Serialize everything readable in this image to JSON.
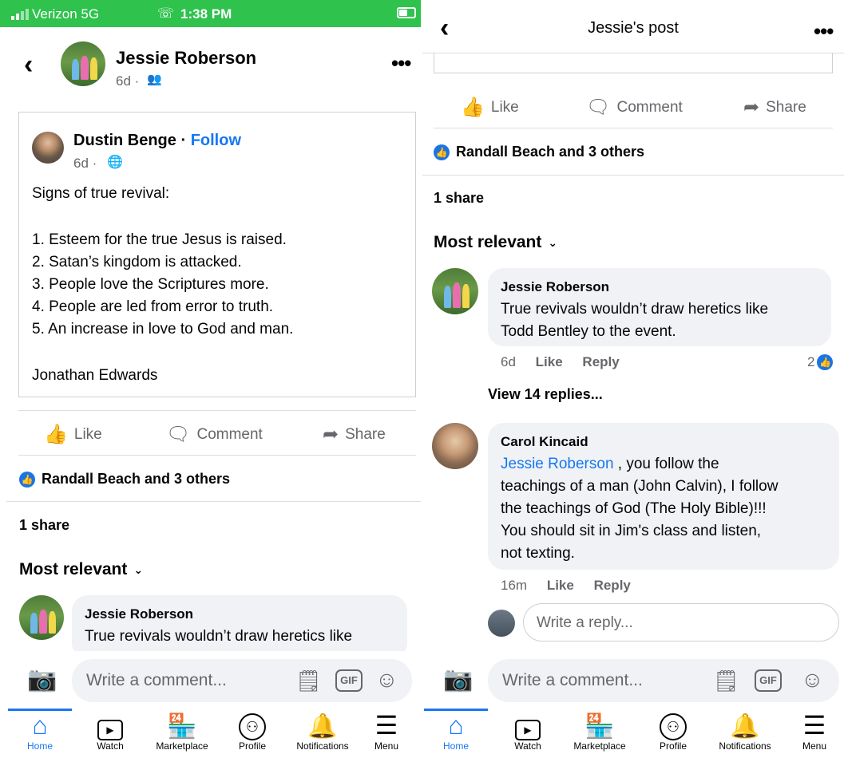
{
  "status_bar": {
    "carrier": "Verizon  5G",
    "time": "1:38 PM"
  },
  "left": {
    "header": {
      "name": "Jessie Roberson",
      "time": "6d ·"
    },
    "shared_post": {
      "author": "Dustin Benge",
      "separator": " · ",
      "follow": "Follow",
      "time": "6d ·",
      "lines": [
        "Signs of true revival:",
        "",
        "1. Esteem for the true Jesus is raised.",
        "2. Satan’s kingdom is attacked.",
        "3. People love the Scriptures more.",
        "4. People are led from error to truth.",
        "5. An increase in love to God and man.",
        "",
        "Jonathan Edwards"
      ]
    },
    "actions": {
      "like": "Like",
      "comment": "Comment",
      "share": "Share"
    },
    "reactions": "Randall Beach and 3 others",
    "shares": "1 share",
    "sort": "Most relevant",
    "comment": {
      "name": "Jessie Roberson",
      "text": "True revivals wouldn’t draw heretics like"
    }
  },
  "right": {
    "header": {
      "title": "Jessie's post"
    },
    "actions": {
      "like": "Like",
      "comment": "Comment",
      "share": "Share"
    },
    "reactions": "Randall Beach and 3 others",
    "shares": "1 share",
    "sort": "Most relevant",
    "comment1": {
      "name": "Jessie Roberson",
      "line1": "True revivals wouldn’t draw heretics like",
      "line2": "Todd Bentley to the event.",
      "time": "6d",
      "like": "Like",
      "reply": "Reply",
      "reaction_count": "2",
      "view_replies": "View 14 replies..."
    },
    "comment2": {
      "name": "Carol Kincaid",
      "mention": "Jessie Roberson",
      "line1_rest": " , you follow the",
      "line2": "teachings of a man (John Calvin), I follow",
      "line3": "the teachings of God (The Holy Bible)!!!",
      "line4": "You should sit in Jim's class and listen,",
      "line5": "not texting.",
      "time": "16m",
      "like": "Like",
      "reply": "Reply"
    },
    "reply_placeholder": "Write a reply..."
  },
  "composer": {
    "placeholder": "Write a comment...",
    "gif": "GIF"
  },
  "tabs": [
    "Home",
    "Watch",
    "Marketplace",
    "Profile",
    "Notifications",
    "Menu"
  ],
  "colors": {
    "brand_blue": "#1877f2",
    "status_green": "#2fc24d",
    "text_gray": "#65676b",
    "bubble_gray": "#f0f2f5"
  }
}
